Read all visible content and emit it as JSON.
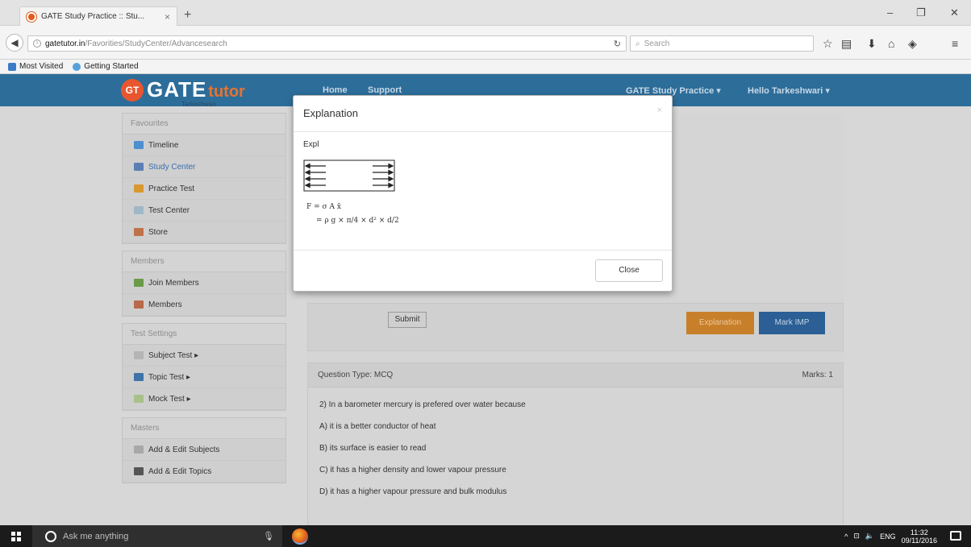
{
  "browser": {
    "tab_title": "GATE Study Practice :: Stu...",
    "tab_close": "×",
    "new_tab": "+",
    "url_host": "gatetutor.in",
    "url_path": "/Favorities/StudyCenter/Advancesearch",
    "search_placeholder": "Search",
    "win_min": "–",
    "win_restore": "❐",
    "win_close": "✕",
    "bookmarks": [
      "Most Visited",
      "Getting Started"
    ]
  },
  "site": {
    "logo_badge": "GT",
    "logo_gate": "GATE",
    "logo_tutor": "tutor",
    "logo_sub": "Tarkeshwari",
    "nav": {
      "home": "Home",
      "support": "Support",
      "practice": "GATE Study Practice ▾",
      "user": "Hello Tarkeshwari ▾"
    }
  },
  "sidebar": {
    "panels": [
      {
        "heading": "Favourites",
        "items": [
          "Timeline",
          "Study Center",
          "Practice Test",
          "Test Center",
          "Store"
        ]
      },
      {
        "heading": "Members",
        "items": [
          "Join Members",
          "Members"
        ]
      },
      {
        "heading": "Test Settings",
        "items": [
          "Subject Test ▸",
          "Topic Test ▸",
          "Mock Test ▸"
        ]
      },
      {
        "heading": "Masters",
        "items": [
          "Add & Edit Subjects",
          "Add & Edit Topics"
        ]
      }
    ]
  },
  "main": {
    "submit_label": "Submit",
    "explanation_label": "Explanation",
    "mark_imp_label": "Mark IMP",
    "question": {
      "type": "Question Type: MCQ",
      "marks": "Marks: 1",
      "text": "2) In a barometer mercury is prefered over water because",
      "options": [
        "A) it is a better conductor of heat",
        "B) its surface is easier to read",
        "C) it has a higher density and lower vapour pressure",
        "D) it has a higher vapour pressure and bulk modulus"
      ]
    }
  },
  "modal": {
    "title": "Explanation",
    "close_x": "×",
    "body_label": "Expl",
    "formula_line1": "F = σ A x̄",
    "formula_line2": "= ρ g × π/4 × d² × d/2",
    "close_label": "Close"
  },
  "taskbar": {
    "search_placeholder": "Ask me anything",
    "lang": "ENG",
    "time": "11:32",
    "date": "09/11/2016"
  }
}
